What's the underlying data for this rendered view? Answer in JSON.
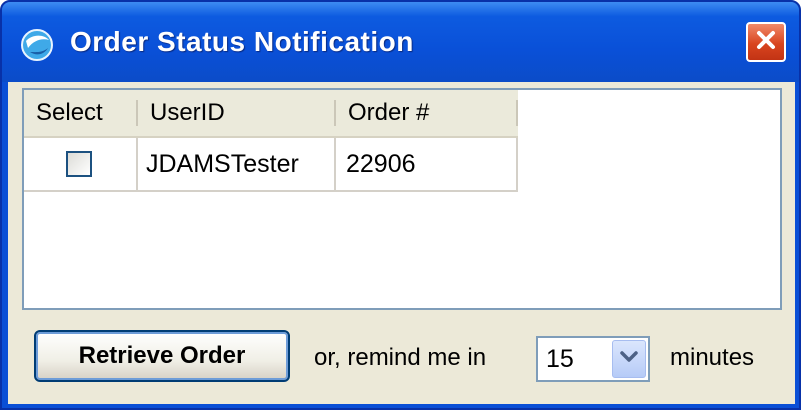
{
  "window": {
    "title": "Order Status Notification",
    "icon": "globe-app-icon",
    "close_icon": "close-icon"
  },
  "grid": {
    "columns": [
      "Select",
      "UserID",
      "Order #"
    ],
    "rows": [
      {
        "selected": false,
        "user_id": "JDAMSTester",
        "order_number": "22906"
      }
    ]
  },
  "footer": {
    "retrieve_label": "Retrieve Order",
    "remind_label": "or, remind me in",
    "remind_value": "15",
    "minutes_label": "minutes"
  },
  "colors": {
    "titlebar": "#0a50d8",
    "close_button": "#d9451f",
    "dialog_bg": "#ece9d8"
  }
}
